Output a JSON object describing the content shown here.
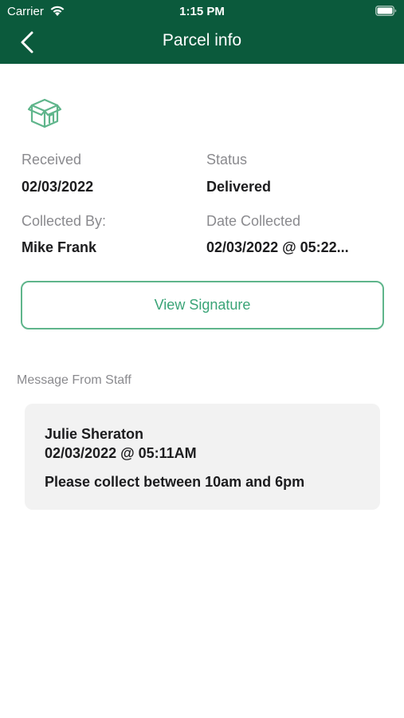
{
  "status_bar": {
    "carrier": "Carrier",
    "time": "1:15 PM"
  },
  "nav": {
    "title": "Parcel info"
  },
  "parcel": {
    "received_label": "Received",
    "received_value": "02/03/2022",
    "status_label": "Status",
    "status_value": "Delivered",
    "collected_by_label": "Collected By:",
    "collected_by_value": "Mike Frank",
    "date_collected_label": "Date Collected",
    "date_collected_value": "02/03/2022 @ 05:22..."
  },
  "actions": {
    "view_signature_label": "View Signature"
  },
  "staff_message": {
    "section_title": "Message From Staff",
    "author": "Julie Sheraton",
    "date": "02/03/2022 @ 05:11AM",
    "text": "Please collect between 10am and 6pm"
  },
  "colors": {
    "header_bg": "#0b5a3c",
    "accent": "#3aa477",
    "card_bg": "#f2f2f2"
  },
  "icons": {
    "back": "chevron-left-icon",
    "parcel": "package-box-icon",
    "wifi": "wifi-icon",
    "battery": "battery-icon"
  }
}
